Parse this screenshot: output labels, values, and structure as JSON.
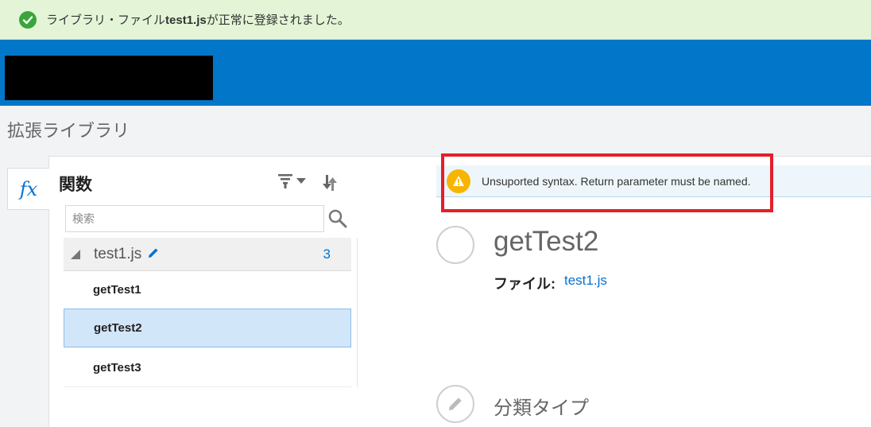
{
  "notification": {
    "prefix": "ライブラリ・ファイル",
    "filename": "test1.js",
    "suffix": "が正常に登録されました。"
  },
  "page": {
    "title": "拡張ライブラリ"
  },
  "fx_tab": {
    "label": "fx"
  },
  "functions_panel": {
    "title": "関数",
    "search_placeholder": "検索",
    "file": {
      "name": "test1.js",
      "count": "3"
    },
    "items": [
      {
        "label": "getTest1",
        "selected": false
      },
      {
        "label": "getTest2",
        "selected": true
      },
      {
        "label": "getTest3",
        "selected": false
      }
    ]
  },
  "warning": {
    "message": "Unsuported syntax. Return parameter must be named."
  },
  "detail": {
    "title": "getTest2",
    "file_label": "ファイル:",
    "file_link": "test1.js",
    "section": "分類タイプ"
  },
  "colors": {
    "brand": "#0277c9",
    "success_bg": "#e3f5d6",
    "warning": "#f7b500",
    "highlight": "#e3202a",
    "link": "#0572ce"
  },
  "icons": [
    "check-circle-icon",
    "fx-icon",
    "filter-icon",
    "chevron-down-icon",
    "sort-icon",
    "search-icon",
    "pencil-icon",
    "collapse-triangle-icon",
    "warning-icon"
  ]
}
